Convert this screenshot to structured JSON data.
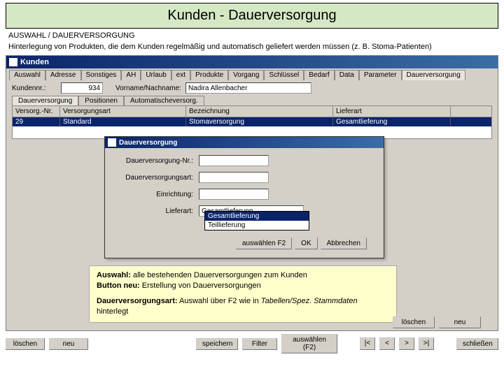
{
  "slide": {
    "title": "Kunden - Dauerversorgung",
    "meta": "AUSWAHL / DAUERVERSORGUNG",
    "desc": "Hinterlegung von Produkten, die dem Kunden regelmäßig und automatisch geliefert werden müssen (z. B. Stoma-Patienten)"
  },
  "window": {
    "title": "Kunden"
  },
  "tabs": [
    "Auswahl",
    "Adresse",
    "Sonstiges",
    "AH",
    "Urlaub",
    "ext",
    "Produkte",
    "Vorgang",
    "Schlüssel",
    "Bedarf",
    "Data",
    "Parameter",
    "Dauerversorgung"
  ],
  "active_tab": 12,
  "customer": {
    "kundennr_label": "Kundennr.:",
    "kundennr": "934",
    "name_label": "Vorname/Nachname:",
    "name": "Nadira Allenbacher"
  },
  "subtabs": [
    "Dauerversorgung",
    "Positionen",
    "Automatischeversorg."
  ],
  "active_subtab": 0,
  "grid": {
    "headers": [
      "Versorg.-Nr.",
      "Versorgungsart",
      "Bezeichnung",
      "Lieferart"
    ],
    "row": [
      "29",
      "Standard",
      "Stomaversorgung",
      "Gesamtlieferung"
    ]
  },
  "dialog": {
    "title": "Dauerversorgung",
    "fields": {
      "nr_label": "Dauerversorgung-Nr.:",
      "art_label": "Dauerversorgungsart:",
      "einricht_label": "Einrichtung:",
      "lieferart_label": "Lieferart:",
      "lieferart_value": "Gesamtlieferung"
    },
    "dropdown_options": [
      "Gesamtlieferung",
      "Teillieferung"
    ],
    "buttons": {
      "aus": "auswählen F2",
      "ok": "OK",
      "cancel": "Abbrechen"
    }
  },
  "note": {
    "l1a": "Auswahl:",
    "l1b": " alle bestehenden Dauerversorgungen zum Kunden",
    "l2a": "Button neu:",
    "l2b": " Erstellung von Dauerversorgungen",
    "l3a": "Dauerversorgungsart:",
    "l3b": " Auswahl über F2 wie in ",
    "l3c": "Tabellen/Spez. Stammdaten",
    "l3d": " hinterlegt"
  },
  "inner_buttons": {
    "loeschen": "löschen",
    "neu": "neu"
  },
  "footer": {
    "loeschen": "löschen",
    "neu": "neu",
    "speichern": "speichern",
    "filter": "Filter",
    "auswaehlen": "auswählen (F2)",
    "nav_first": "|<",
    "nav_prev": "<",
    "nav_next": ">",
    "nav_last": ">|",
    "schliessen": "schließen"
  }
}
